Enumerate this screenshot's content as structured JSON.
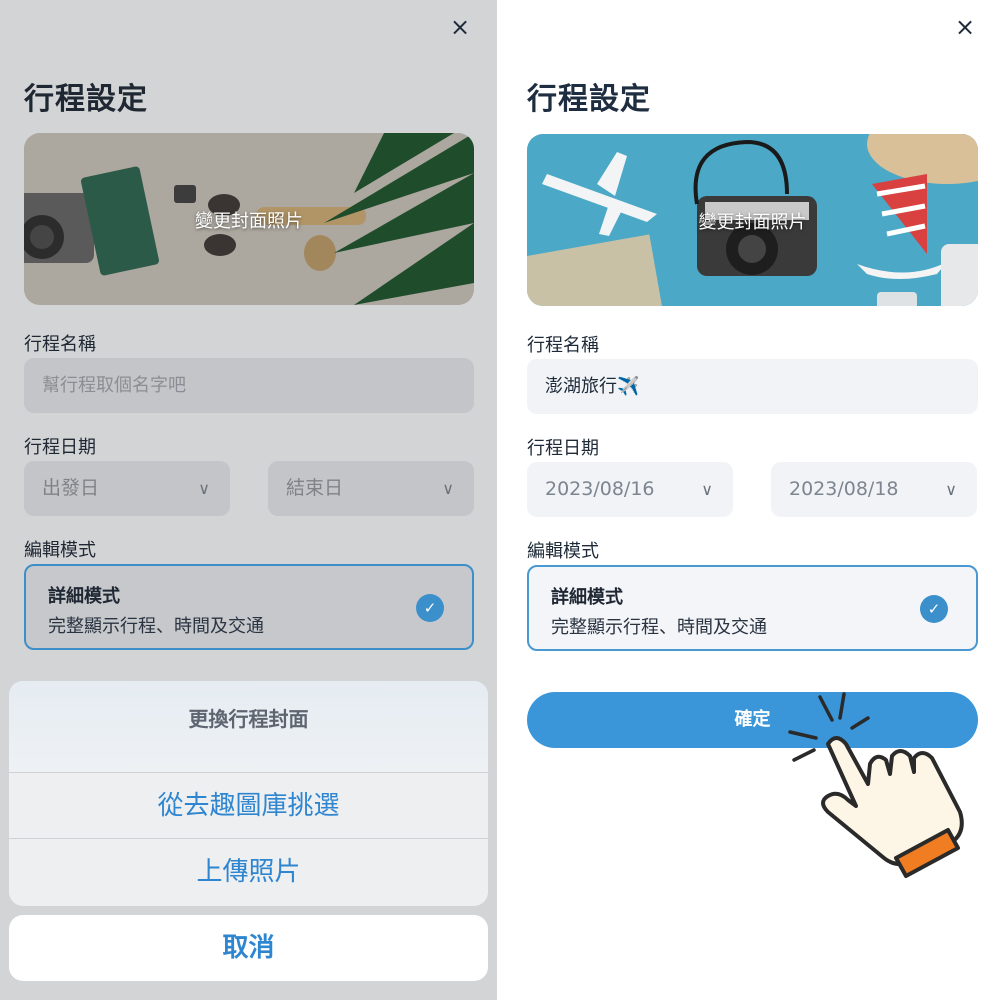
{
  "left_panel": {
    "close_symbol": "×",
    "title": "行程設定",
    "cover_caption": "變更封面照片",
    "name_label": "行程名稱",
    "name_placeholder": "幫行程取個名字吧",
    "date_label": "行程日期",
    "start_date": "出發日",
    "end_date": "結束日",
    "mode_label": "編輯模式",
    "mode_title": "詳細模式",
    "mode_desc": "完整顯示行程、時間及交通",
    "sheet": {
      "title": "更換行程封面",
      "option_gallery": "從去趣圖庫挑選",
      "option_upload": "上傳照片",
      "cancel": "取消"
    }
  },
  "right_panel": {
    "close_symbol": "×",
    "title": "行程設定",
    "cover_caption": "變更封面照片",
    "name_label": "行程名稱",
    "name_value": "澎湖旅行✈️",
    "date_label": "行程日期",
    "start_date": "2023/08/16",
    "end_date": "2023/08/18",
    "mode_label": "編輯模式",
    "mode_title": "詳細模式",
    "mode_desc": "完整顯示行程、時間及交通",
    "confirm": "確定"
  },
  "icons": {
    "close": "close-icon",
    "chevron": "chevron-down-icon",
    "check": "check-circle-icon",
    "hand": "tap-hand-icon"
  },
  "colors": {
    "accent": "#3a96d8",
    "title": "#1e2d3f",
    "hand_cuff": "#f07d22"
  }
}
